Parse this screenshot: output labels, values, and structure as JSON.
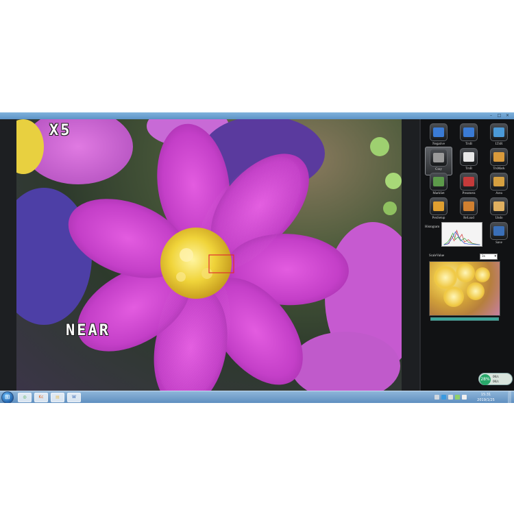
{
  "camera": {
    "zoom_text": "X5",
    "focus_text": "NEAR"
  },
  "tools": [
    {
      "label": "Negative",
      "icon": "negative-icon",
      "color": "#3a7bd5"
    },
    {
      "label": "TrsB",
      "icon": "trsb-icon",
      "color": "#3a7bd5"
    },
    {
      "label": "LTsR",
      "icon": "ltsr-icon",
      "color": "#4b9ad8"
    },
    {
      "label": "Gray",
      "icon": "gray-icon",
      "color": "#9a9a9a",
      "active": true
    },
    {
      "label": "TrsB",
      "icon": "trsb2-icon",
      "color": "#e8e8e8"
    },
    {
      "label": "TrsMark",
      "icon": "trsmark-icon",
      "color": "#d99a3b"
    },
    {
      "label": "MarkSet",
      "icon": "markset-icon",
      "color": "#5c9a4a"
    },
    {
      "label": "Preamera",
      "icon": "preamera-icon",
      "color": "#c43a3a"
    },
    {
      "label": "Area",
      "icon": "area-icon",
      "color": "#d6a040"
    },
    {
      "label": "PenSetup",
      "icon": "pensetup-icon",
      "color": "#e0a030"
    },
    {
      "label": "ReLoad",
      "icon": "reload-icon",
      "color": "#d08030"
    },
    {
      "label": "Undo",
      "icon": "undo-icon",
      "color": "#e0b060"
    },
    {
      "label": "Save",
      "icon": "save-icon",
      "color": "#3a6fb8"
    }
  ],
  "histogram": {
    "label": "Histogram"
  },
  "scale": {
    "label": "ScaleValue",
    "selected": "3x"
  },
  "progress": {
    "value": 1.0
  },
  "network": {
    "percent": "28%",
    "up": "0K/s",
    "down": "0K/s"
  },
  "taskbar": {
    "apps": [
      {
        "name": "taskbar-app-media",
        "text": "◎",
        "color": "#46a84a"
      },
      {
        "name": "taskbar-app-kc",
        "text": "Kc",
        "color": "#e06420"
      },
      {
        "name": "taskbar-app-explorer",
        "text": "▤",
        "color": "#e8c060"
      },
      {
        "name": "taskbar-app-word",
        "text": "W",
        "color": "#2a5fb0"
      }
    ],
    "clock_time": "15:31",
    "clock_date": "2019/1/25"
  }
}
